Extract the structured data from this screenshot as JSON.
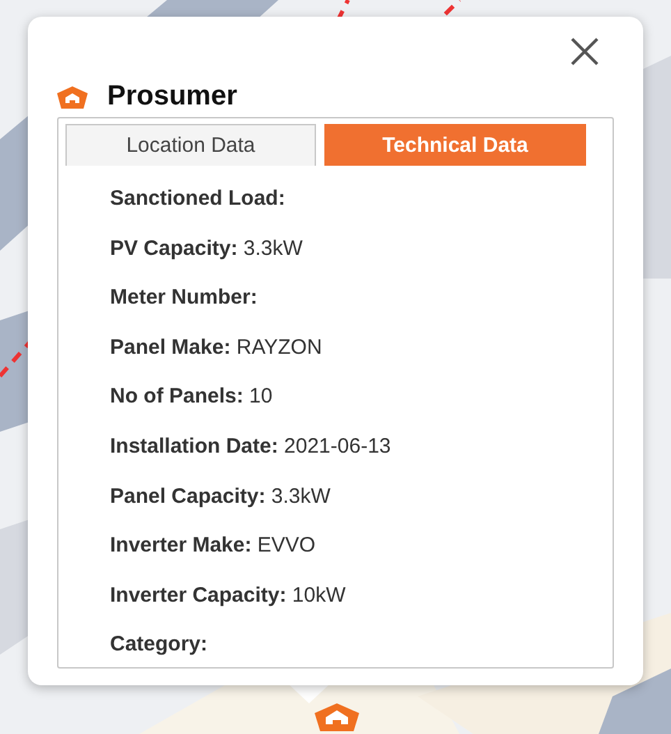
{
  "popup": {
    "title": "Prosumer",
    "tabs": [
      {
        "label": "Location Data",
        "selected": false
      },
      {
        "label": "Technical Data",
        "selected": true
      }
    ],
    "details": [
      {
        "label": "Sanctioned Load:"
      },
      {
        "label": "PV Capacity:",
        "value": "3.3kW"
      },
      {
        "label": "Meter Number:"
      },
      {
        "label": "Panel Make:",
        "value": "RAYZON"
      },
      {
        "label": "No of Panels:",
        "value": "10"
      },
      {
        "label": "Installation Date:",
        "value": "2021-06-13"
      },
      {
        "label": "Panel Capacity:",
        "value": "3.3kW"
      },
      {
        "label": "Inverter Make:",
        "value": "EVVO"
      },
      {
        "label": "Inverter Capacity:",
        "value": "10kW"
      },
      {
        "label": "Category:"
      }
    ]
  }
}
